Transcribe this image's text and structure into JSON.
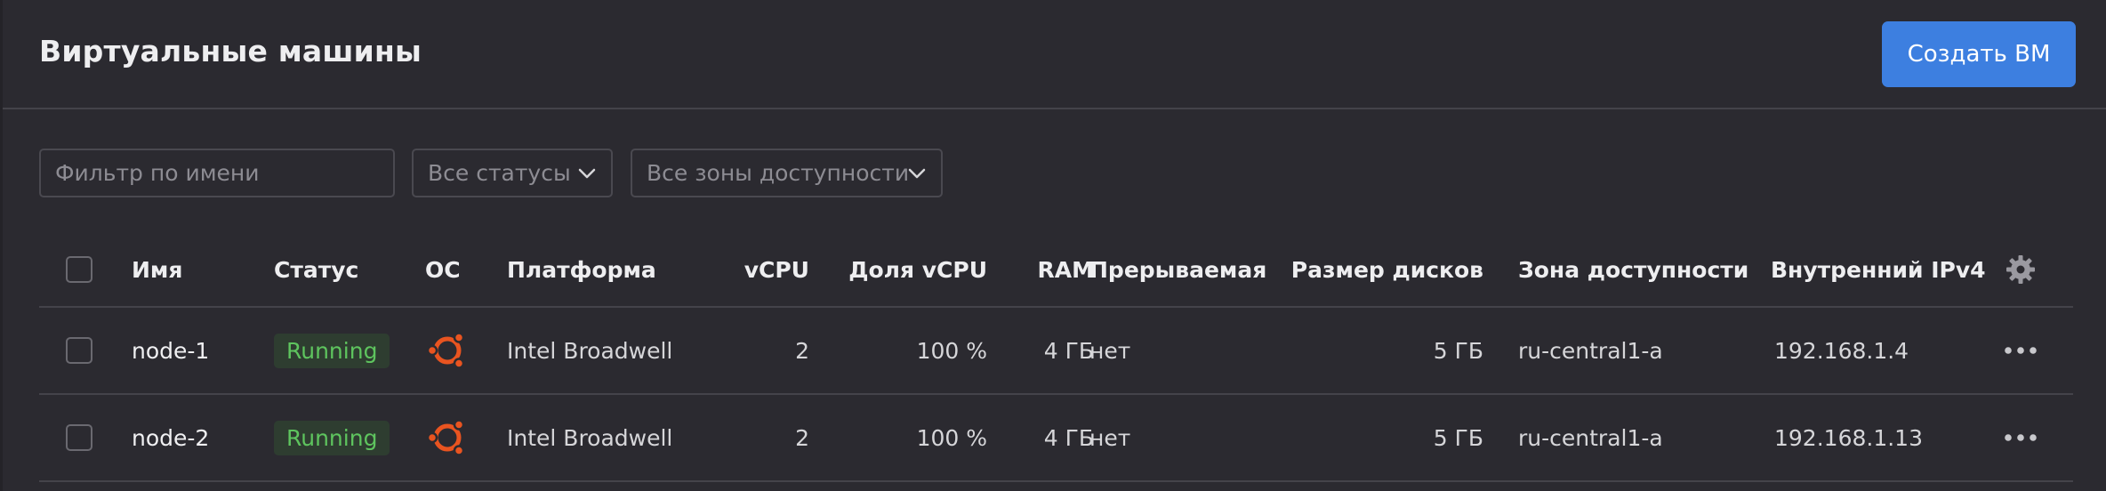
{
  "header": {
    "title": "Виртуальные машины",
    "create_button": "Создать ВМ"
  },
  "filters": {
    "name_placeholder": "Фильтр по имени",
    "status_select": "Все статусы",
    "zone_select": "Все зоны доступности"
  },
  "table": {
    "columns": {
      "name": "Имя",
      "status": "Статус",
      "os": "ОС",
      "platform": "Платформа",
      "vcpu": "vCPU",
      "vcpu_share": "Доля vCPU",
      "ram": "RAM",
      "preemptible": "Прерываемая",
      "disk_size": "Размер дисков",
      "zone": "Зона доступности",
      "internal_ipv4": "Внутренний IPv4"
    },
    "rows": [
      {
        "name": "node-1",
        "status": "Running",
        "os_icon": "ubuntu-icon",
        "platform": "Intel Broadwell",
        "vcpu": "2",
        "vcpu_share": "100 %",
        "ram": "4 ГБ",
        "preemptible": "нет",
        "disk_size": "5 ГБ",
        "zone": "ru-central1-a",
        "internal_ipv4": "192.168.1.4"
      },
      {
        "name": "node-2",
        "status": "Running",
        "os_icon": "ubuntu-icon",
        "platform": "Intel Broadwell",
        "vcpu": "2",
        "vcpu_share": "100 %",
        "ram": "4 ГБ",
        "preemptible": "нет",
        "disk_size": "5 ГБ",
        "zone": "ru-central1-a",
        "internal_ipv4": "192.168.1.13"
      }
    ]
  },
  "colors": {
    "background": "#2b2a30",
    "accent": "#3d7fe0",
    "status_running": "#5ec45e",
    "os_ubuntu": "#e95420"
  }
}
